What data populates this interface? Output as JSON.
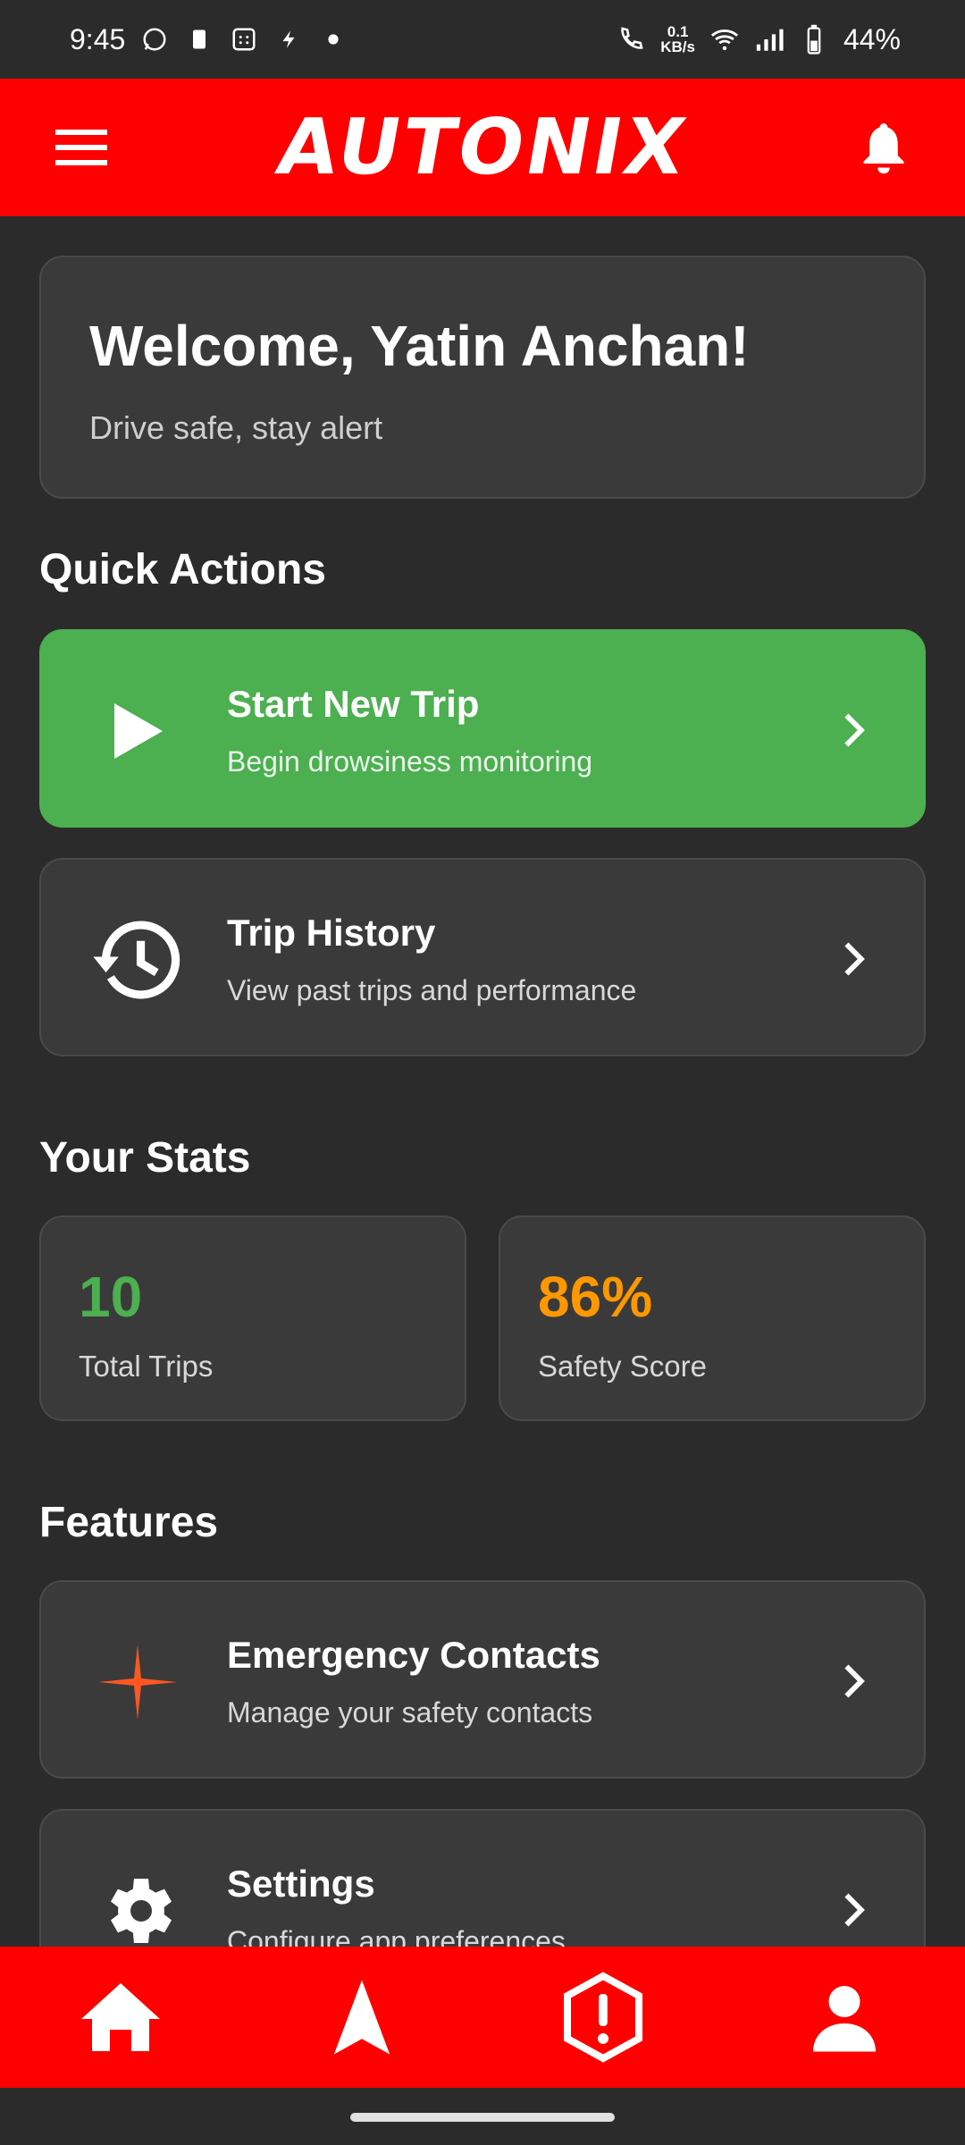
{
  "status_bar": {
    "time": "9:45",
    "net_speed_top": "0.1",
    "net_speed_bottom": "KB/s",
    "battery": "44%"
  },
  "app_bar": {
    "title": "AUTONIX",
    "menu_icon": "menu-icon",
    "notification_icon": "bell-icon",
    "color": "#ff0000"
  },
  "welcome": {
    "title": "Welcome, Yatin Anchan!",
    "subtitle": "Drive safe, stay alert"
  },
  "quick_actions": {
    "heading": "Quick Actions",
    "items": [
      {
        "title": "Start New Trip",
        "subtitle": "Begin drowsiness monitoring",
        "icon": "play-icon",
        "color": "#4caf50"
      },
      {
        "title": "Trip History",
        "subtitle": "View past trips and performance",
        "icon": "history-icon"
      }
    ]
  },
  "stats": {
    "heading": "Your Stats",
    "items": [
      {
        "value": "10",
        "label": "Total Trips",
        "color": "#4caf50"
      },
      {
        "value": "86%",
        "label": "Safety Score",
        "color": "#ff9800"
      }
    ]
  },
  "features": {
    "heading": "Features",
    "items": [
      {
        "title": "Emergency Contacts",
        "subtitle": "Manage your safety contacts",
        "icon": "sparkle-icon"
      },
      {
        "title": "Settings",
        "subtitle": "Configure app preferences",
        "icon": "gear-icon"
      }
    ]
  },
  "bottom_nav": {
    "items": [
      "home-icon",
      "navigation-icon",
      "alert-icon",
      "person-icon"
    ]
  }
}
